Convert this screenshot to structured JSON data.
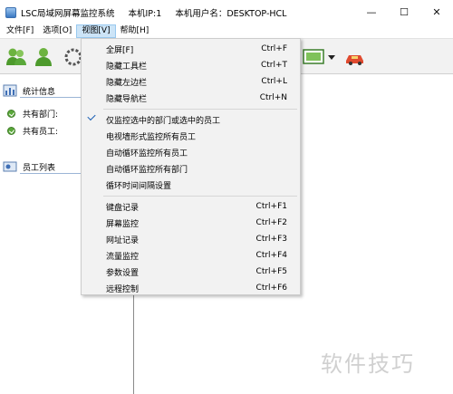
{
  "window": {
    "title_parts": [
      "LSC局域网屏幕监控系统",
      "本机IP:1",
      "本机用户名：DESKTOP-HCL"
    ],
    "minimize_glyph": "—",
    "maximize_glyph": "☐",
    "close_glyph": "✕"
  },
  "menubar": {
    "items": [
      {
        "label": "文件[F]"
      },
      {
        "label": "选项[O]"
      },
      {
        "label": "视图[V]",
        "active": true
      },
      {
        "label": "帮助[H]"
      }
    ]
  },
  "toolbar": {
    "icons": [
      "users-add-icon",
      "users-group-icon",
      "gear-icon",
      "screen-monitor-icon",
      "dropdown-arrow-icon",
      "car-icon"
    ]
  },
  "left_panel": {
    "stats_header": "统计信息",
    "dept_label": "共有部门:",
    "staff_label": "共有员工:",
    "staff_list_header": "员工列表"
  },
  "view_menu": {
    "items": [
      {
        "label": "全屏[F]",
        "shortcut": "Ctrl+F"
      },
      {
        "label": "隐藏工具栏",
        "shortcut": "Ctrl+T"
      },
      {
        "label": "隐藏左边栏",
        "shortcut": "Ctrl+L"
      },
      {
        "label": "隐藏导航栏",
        "shortcut": "Ctrl+N"
      },
      {
        "label": "仅监控选中的部门或选中的员工",
        "shortcut": "",
        "checked": true
      },
      {
        "label": "电视墙形式监控所有员工",
        "shortcut": ""
      },
      {
        "label": "自动循环监控所有员工",
        "shortcut": ""
      },
      {
        "label": "自动循环监控所有部门",
        "shortcut": ""
      },
      {
        "label": "循环时间间隔设置",
        "shortcut": ""
      },
      {
        "label": "键盘记录",
        "shortcut": "Ctrl+F1"
      },
      {
        "label": "屏幕监控",
        "shortcut": "Ctrl+F2"
      },
      {
        "label": "网址记录",
        "shortcut": "Ctrl+F3"
      },
      {
        "label": "流量监控",
        "shortcut": "Ctrl+F4"
      },
      {
        "label": "参数设置",
        "shortcut": "Ctrl+F5"
      },
      {
        "label": "远程控制",
        "shortcut": "Ctrl+F6"
      }
    ]
  },
  "watermark": "软件技巧",
  "colors": {
    "menu_highlight": "#cce4f7",
    "check_accent": "#1a5fb4",
    "status_green": "#5aa83a"
  }
}
